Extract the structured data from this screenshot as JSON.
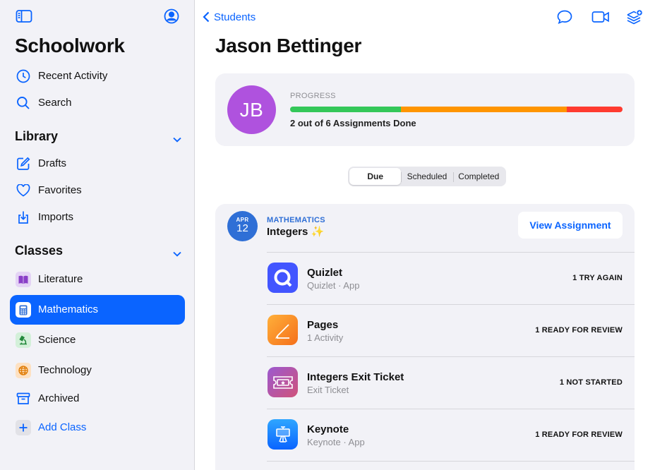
{
  "sidebar": {
    "title": "Schoolwork",
    "items": [
      {
        "label": "Recent Activity",
        "icon": "clock-icon"
      },
      {
        "label": "Search",
        "icon": "search-icon"
      }
    ],
    "library": {
      "heading": "Library",
      "items": [
        {
          "label": "Drafts",
          "icon": "compose-icon"
        },
        {
          "label": "Favorites",
          "icon": "heart-icon"
        },
        {
          "label": "Imports",
          "icon": "import-icon"
        }
      ]
    },
    "classes": {
      "heading": "Classes",
      "items": [
        {
          "label": "Literature",
          "icon": "book-icon",
          "color": "#af52de"
        },
        {
          "label": "Mathematics",
          "icon": "calculator-icon",
          "color": "#ffffff",
          "selected": true
        },
        {
          "label": "Science",
          "icon": "microscope-icon",
          "color": "#34c759"
        },
        {
          "label": "Technology",
          "icon": "globe-icon",
          "color": "#ff9500"
        },
        {
          "label": "Archived",
          "icon": "archive-icon"
        },
        {
          "label": "Add Class",
          "icon": "plus-icon"
        }
      ]
    }
  },
  "header": {
    "back_label": "Students"
  },
  "student": {
    "name": "Jason Bettinger",
    "initials": "JB",
    "avatar_color": "#af52de",
    "progress_label": "PROGRESS",
    "progress_text": "2 out of 6 Assignments Done",
    "progress_segments": [
      {
        "status": "done",
        "fraction": 0.333,
        "color": "#34c759"
      },
      {
        "status": "in-progress",
        "fraction": 0.5,
        "color": "#ff9500"
      },
      {
        "status": "not-started",
        "fraction": 0.167,
        "color": "#ff3b30"
      }
    ]
  },
  "tabs": [
    {
      "label": "Due",
      "selected": true
    },
    {
      "label": "Scheduled",
      "selected": false
    },
    {
      "label": "Completed",
      "selected": false
    }
  ],
  "assignment": {
    "month": "APR",
    "day": "12",
    "subject": "MATHEMATICS",
    "title": "Integers",
    "title_emoji": "✨",
    "view_button": "View Assignment",
    "activities": [
      {
        "name": "Quizlet",
        "sub": "Quizlet · App",
        "status": "1 TRY AGAIN",
        "icon": "quizlet-icon"
      },
      {
        "name": "Pages",
        "sub": "1 Activity",
        "status": "1 READY FOR REVIEW",
        "icon": "pages-icon"
      },
      {
        "name": "Integers Exit Ticket",
        "sub": "Exit Ticket",
        "status": "1 NOT STARTED",
        "icon": "exit-ticket-icon"
      },
      {
        "name": "Keynote",
        "sub": "Keynote · App",
        "status": "1 READY FOR REVIEW",
        "icon": "keynote-icon"
      }
    ]
  },
  "colors": {
    "accent": "#0a64ff",
    "math_blue": "#2f6fd6"
  }
}
